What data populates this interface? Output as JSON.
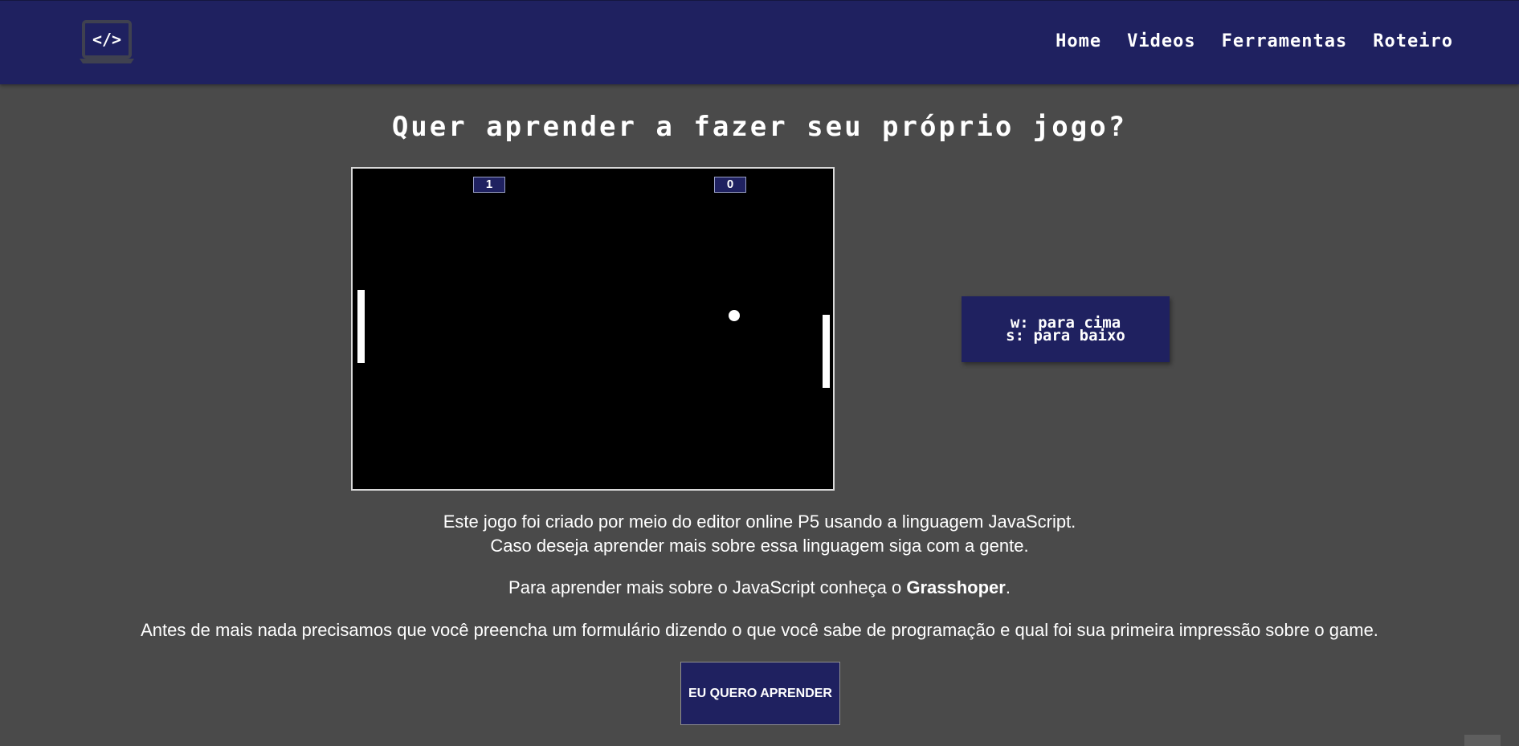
{
  "header": {
    "logo_icon": "laptop-code-icon",
    "nav": [
      "Home",
      "Videos",
      "Ferramentas",
      "Roteiro"
    ]
  },
  "title": "Quer aprender a fazer seu próprio jogo?",
  "game": {
    "score_left": "1",
    "score_right": "0"
  },
  "controls": {
    "line1": "w: para cima",
    "line2": "s: para baixo"
  },
  "intro": {
    "line1": "Este jogo foi criado por meio do editor online P5 usando a linguagem JavaScript.",
    "line2": "Caso deseja aprender mais sobre essa linguagem siga com a gente."
  },
  "learn_more": {
    "prefix": "Para aprender mais sobre o JavaScript conheça o ",
    "link": "Grasshoper",
    "suffix": "."
  },
  "form_note": "Antes de mais nada precisamos que você preencha um formulário dizendo o que você sabe de programação e qual foi sua primeira impressão sobre o game.",
  "cta": {
    "label": "EU QUERO APRENDER"
  },
  "colors": {
    "background": "#4a4a4a",
    "brand": "#1f2160"
  }
}
